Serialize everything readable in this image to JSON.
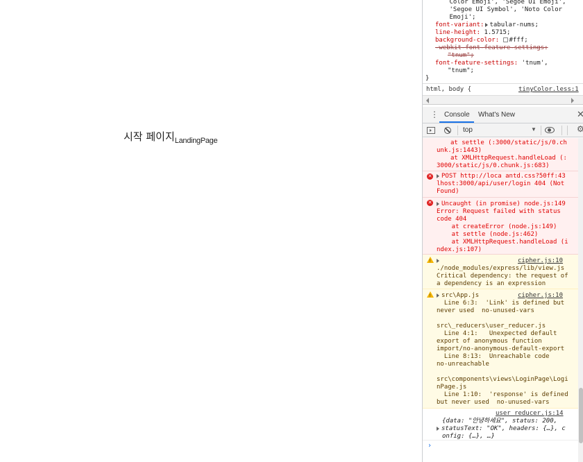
{
  "landing": {
    "title_korean": "시작 페이지",
    "title_suffix": "LandingPage"
  },
  "styles_pane": {
    "lines": [
      {
        "text": "      Color Emoji', 'Segoe UI Emoji',",
        "kind": "value"
      },
      {
        "text": "      'Segoe UI Symbol', 'Noto Color",
        "kind": "value"
      },
      {
        "text": "      Emoji';",
        "kind": "value"
      }
    ],
    "font_variant_prop": "font-variant:",
    "font_variant_val": "tabular-nums;",
    "line_height_prop": "line-height:",
    "line_height_val": "1.5715;",
    "bg_prop": "background-color:",
    "bg_val": "#fff;",
    "webkit_prop": "-webkit-font-feature-settings:",
    "webkit_val": "\"tnum\";",
    "ffs_prop": "font-feature-settings:",
    "ffs_val": "'tnum',",
    "ffs_val2": "\"tnum\";",
    "close_brace": "}",
    "selector": "html, body {",
    "selector_source": "tinyColor.less:1"
  },
  "tabs": {
    "console": "Console",
    "whats_new": "What's New"
  },
  "toolbar": {
    "context": "top"
  },
  "console": {
    "msg1": {
      "l1": "at settle (:3000/static/js/0.ch",
      "l2": "unk.js:1443)",
      "l3": "at XMLHttpRequest.handleLoad (:",
      "l4": "3000/static/js/0.chunk.js:683)"
    },
    "msg2": {
      "l1": "POST http://loca antd.css?50ff:43",
      "l2": "lhost:3000/api/user/login 404 (Not",
      "l3": "Found)"
    },
    "msg3": {
      "l1": "Uncaught (in promise) node.js:149",
      "l2": "Error: Request failed with status",
      "l3": "code 404",
      "l4": "    at createError (node.js:149)",
      "l5": "    at settle (node.js:462)",
      "l6": "    at XMLHttpRequest.handleLoad (i",
      "l7": "ndex.js:107)"
    },
    "msg4": {
      "source": "cipher.js:10",
      "l1": "./node_modules/express/lib/view.js",
      "l2": "Critical dependency: the request of",
      "l3": "a dependency is an expression"
    },
    "msg5": {
      "head": "src\\App.js",
      "source": "cipher.js:10",
      "lines": [
        "  Line 6:3:  'Link' is defined but",
        "never used  no-unused-vars",
        "",
        "src\\_reducers\\user_reducer.js",
        "  Line 4:1:   Unexpected default",
        "export of anonymous function",
        "import/no-anonymous-default-export",
        "  Line 8:13:  Unreachable code",
        "no-unreachable",
        "",
        "src\\components\\views\\LoginPage\\Logi",
        "nPage.js",
        "  Line 1:10:  'response' is defined",
        "but never used  no-unused-vars"
      ]
    },
    "msg6": {
      "source": "user_reducer.js:14",
      "l1": "{data: \"안녕하세요\", status: 200,",
      "l2": "statusText: \"OK\", headers: {…}, c",
      "l3": "onfig: {…}, …}"
    }
  }
}
